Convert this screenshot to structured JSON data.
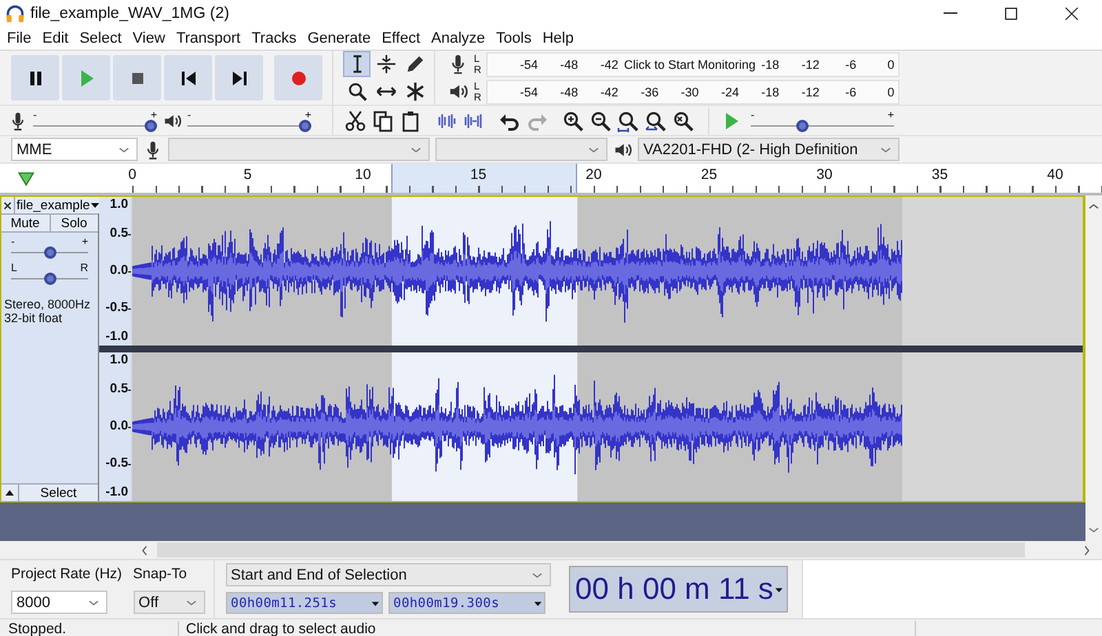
{
  "window": {
    "title": "file_example_WAV_1MG (2)"
  },
  "menu": [
    "File",
    "Edit",
    "Select",
    "View",
    "Transport",
    "Tracks",
    "Generate",
    "Effect",
    "Analyze",
    "Tools",
    "Help"
  ],
  "tools": [
    {
      "kind": "select",
      "selected": true
    },
    {
      "kind": "envelope",
      "selected": false
    },
    {
      "kind": "draw",
      "selected": false
    },
    {
      "kind": "zoom",
      "selected": false
    },
    {
      "kind": "timeshift",
      "selected": false
    },
    {
      "kind": "multi",
      "selected": false
    }
  ],
  "recording_meter": {
    "channels": [
      "L",
      "R"
    ],
    "ticks_before": [
      "-54",
      "-48",
      "-42"
    ],
    "prompt": "Click to Start Monitoring",
    "ticks_after": [
      "-18",
      "-12",
      "-6",
      "0"
    ]
  },
  "playback_meter": {
    "channels": [
      "L",
      "R"
    ],
    "ticks": [
      "-54",
      "-48",
      "-42",
      "-36",
      "-30",
      "-24",
      "-18",
      "-12",
      "-6",
      "0"
    ]
  },
  "recording_volume": {
    "level": 1,
    "min_label": "-",
    "max_label": "+"
  },
  "playback_volume": {
    "level": 1,
    "min_label": "-",
    "max_label": "+"
  },
  "edit_tools": [
    {
      "kind": "cut",
      "disabled": false
    },
    {
      "kind": "copy",
      "disabled": false
    },
    {
      "kind": "paste",
      "disabled": false
    },
    {
      "kind": "trim",
      "disabled": false
    },
    {
      "kind": "silence",
      "disabled": false
    },
    {
      "kind": "undo",
      "disabled": false
    },
    {
      "kind": "redo",
      "disabled": true
    },
    {
      "kind": "zoom_in",
      "disabled": false
    },
    {
      "kind": "zoom_out",
      "disabled": false
    },
    {
      "kind": "fit_selection",
      "disabled": false
    },
    {
      "kind": "fit_project",
      "disabled": false
    },
    {
      "kind": "zoom_toggle",
      "disabled": false
    }
  ],
  "play_at_speed": {
    "level": 0.35,
    "min_label": "-",
    "max_label": "+"
  },
  "devices": {
    "host": "MME",
    "output": "VA2201-FHD (2- High Definition"
  },
  "timeline": {
    "labels": [
      "0",
      "5",
      "10",
      "15",
      "20",
      "25",
      "30",
      "35",
      "40"
    ]
  },
  "track": {
    "name": "file_example",
    "mute": "Mute",
    "solo": "Solo",
    "gain": {
      "level": 0.5,
      "min_label": "-",
      "max_label": "+"
    },
    "pan": {
      "level": 0.5,
      "min_label": "L",
      "max_label": "R"
    },
    "info": [
      "Stereo, 8000Hz",
      "32-bit float"
    ],
    "select": "Select",
    "channels": [
      {
        "scale": [
          "1.0",
          "0.5",
          "0.0",
          "-0.5",
          "-1.0"
        ]
      },
      {
        "scale": [
          "1.0",
          "0.5",
          "0.0",
          "-0.5",
          "-1.0"
        ]
      }
    ]
  },
  "selection_toolbar": {
    "project_rate": {
      "label": "Project Rate (Hz)",
      "value": "8000"
    },
    "snap_to": {
      "label": "Snap-To",
      "value": "Off"
    },
    "format": "Start and End of Selection",
    "start": "00h00m11.251s",
    "end": "00h00m19.300s",
    "audio_position": "00 h 00 m 11 s"
  },
  "status_bar": [
    "Stopped.",
    "Click and drag to select audio"
  ]
}
